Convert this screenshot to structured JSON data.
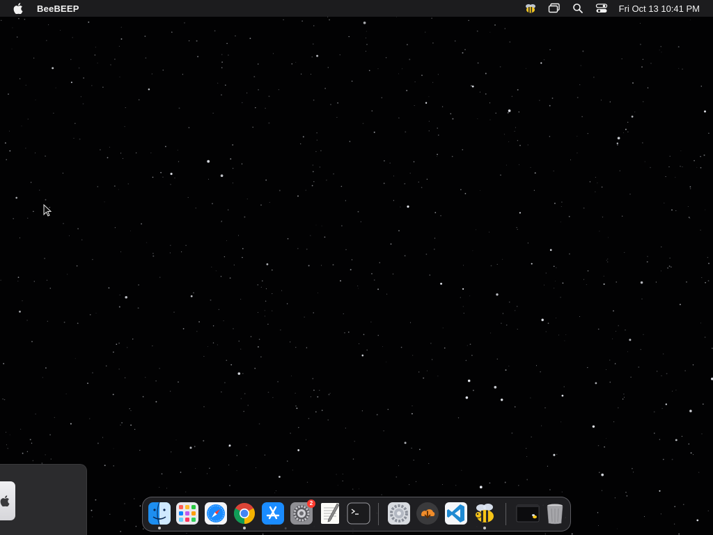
{
  "menubar": {
    "app_name": "BeeBEEP",
    "clock": "Fri Oct 13  10:41 PM",
    "status_icons": [
      "beebeep-icon",
      "screen-mirroring-icon",
      "search-icon",
      "control-center-icon"
    ]
  },
  "dock": {
    "apps": [
      {
        "name": "finder",
        "running": true
      },
      {
        "name": "launchpad",
        "running": false
      },
      {
        "name": "safari",
        "running": false
      },
      {
        "name": "chrome",
        "running": true
      },
      {
        "name": "app-store",
        "running": false
      },
      {
        "name": "system-settings",
        "running": false,
        "badge": "2"
      },
      {
        "name": "textedit",
        "running": false
      },
      {
        "name": "terminal",
        "running": false
      },
      {
        "name": "system-preferences",
        "running": false
      },
      {
        "name": "transmission-download",
        "running": false
      },
      {
        "name": "vscode",
        "running": false
      },
      {
        "name": "beebeep",
        "running": true
      },
      {
        "name": "minimized-window",
        "running": false
      },
      {
        "name": "trash",
        "running": false
      }
    ]
  },
  "colors": {
    "menubar_bg": "#1c1c1e",
    "desktop_bg": "#020203",
    "dock_bg": "#28282c",
    "badge": "#ff3b30",
    "vscode_blue": "#1f8ad2",
    "finder_blue": "#1d8ef0"
  }
}
